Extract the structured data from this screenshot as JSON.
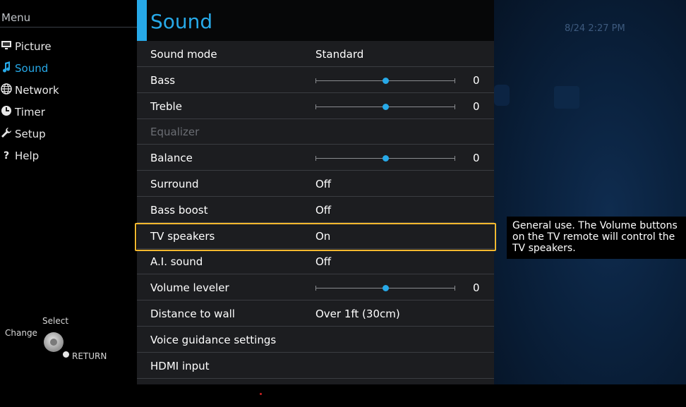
{
  "clock": "8/24 2:27 PM",
  "menu": {
    "title": "Menu",
    "items": [
      {
        "label": "Picture",
        "icon": "picture-icon"
      },
      {
        "label": "Sound",
        "icon": "music-note-icon",
        "active": true
      },
      {
        "label": "Network",
        "icon": "globe-icon"
      },
      {
        "label": "Timer",
        "icon": "clock-icon"
      },
      {
        "label": "Setup",
        "icon": "wrench-icon"
      },
      {
        "label": "Help",
        "icon": "question-icon"
      }
    ]
  },
  "hints": {
    "select": "Select",
    "change": "Change",
    "return": "RETURN"
  },
  "panel": {
    "title": "Sound",
    "rows": [
      {
        "label": "Sound mode",
        "value": "Standard"
      },
      {
        "label": "Bass",
        "slider": 0.5,
        "value": "0"
      },
      {
        "label": "Treble",
        "slider": 0.5,
        "value": "0"
      },
      {
        "label": "Equalizer",
        "disabled": true
      },
      {
        "label": "Balance",
        "slider": 0.5,
        "value": "0"
      },
      {
        "label": "Surround",
        "value": "Off"
      },
      {
        "label": "Bass boost",
        "value": "Off"
      },
      {
        "label": "TV speakers",
        "value": "On",
        "focused": true
      },
      {
        "label": "A.I. sound",
        "value": "Off"
      },
      {
        "label": "Volume leveler",
        "slider": 0.5,
        "value": "0"
      },
      {
        "label": "Distance to wall",
        "value": "Over 1ft (30cm)"
      },
      {
        "label": "Voice guidance settings"
      },
      {
        "label": "HDMI input"
      }
    ]
  },
  "tooltip": {
    "line1": "General use. The Volume buttons",
    "line2": "on the TV remote will control the",
    "line3": "TV speakers."
  },
  "colors": {
    "accent": "#27a9e8",
    "focus": "#f5b82e",
    "panel": "#1c1d20"
  }
}
